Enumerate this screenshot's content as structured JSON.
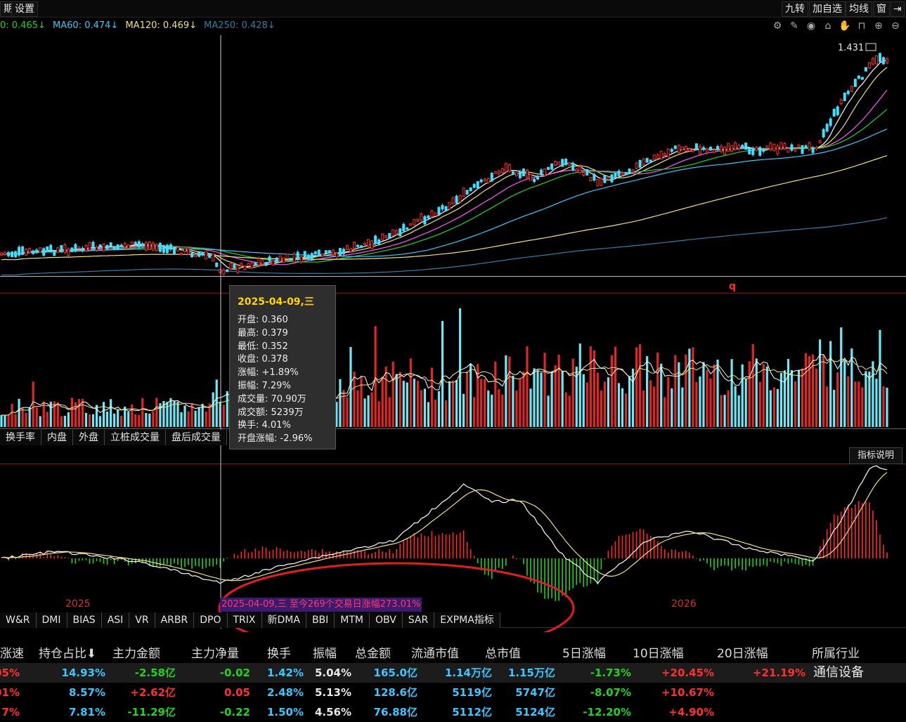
{
  "topbar": {
    "left_buttons": [
      "期",
      "设置"
    ],
    "right_buttons": [
      "九转",
      "加自选",
      "均线",
      "窗"
    ]
  },
  "ma": [
    {
      "label": "0: 0.465↓",
      "color": "#21d321"
    },
    {
      "label": "MA60: 0.474↓",
      "color": "#39c8ff"
    },
    {
      "label": "MA120: 0.469↓",
      "color": "#f2e07a"
    },
    {
      "label": "MA250: 0.428↓",
      "color": "#2f7fa8"
    }
  ],
  "toolbar_icons": [
    "gear-icon",
    "pen-icon",
    "eye-icon",
    "trash-icon",
    "hand-icon",
    "lock-icon",
    "zoom-in-icon",
    "zoom-out-icon"
  ],
  "price_peak_label": "1.431",
  "volume_marker": "q",
  "tooltip": {
    "date": "2025-04-09,三",
    "rows": [
      "开盘: 0.360",
      "最高: 0.379",
      "最低: 0.352",
      "收盘: 0.378",
      "涨幅: +1.89%",
      "振幅: 7.29%",
      "成交量: 70.90万",
      "成交额: 5239万",
      "换手: 4.01%",
      "开盘涨幅: -2.96%"
    ]
  },
  "volume_tabs": [
    "换手率",
    "内盘",
    "外盘",
    "立桩成交量",
    "盘后成交量"
  ],
  "indicator_help": "指标说明",
  "years": [
    "2025",
    "2026"
  ],
  "annotation": "2025-04-09,三 至今269个交易日涨幅273.01%",
  "indicator_tabs": [
    "W&R",
    "DMI",
    "BIAS",
    "ASI",
    "VR",
    "ARBR",
    "DPO",
    "TRIX",
    "新DMA",
    "BBI",
    "MTM",
    "OBV",
    "SAR",
    "EXPMA指标"
  ],
  "table": {
    "headers": [
      "涨速",
      "持仓占比⬇",
      "主力金额",
      "主力净量",
      "换手",
      "振幅",
      "总金额",
      "流通市值",
      "总市值",
      "5日涨幅",
      "10日涨幅",
      "20日涨幅",
      "所属行业"
    ],
    "rows": [
      [
        "05%",
        "14.93%",
        "-2.58亿",
        "-0.02",
        "1.42%",
        "5.04%",
        "165.0亿",
        "1.14万亿",
        "1.15万亿",
        "-1.73%",
        "+20.45%",
        "+21.19%",
        "通信设备"
      ],
      [
        "01%",
        "8.57%",
        "+2.62亿",
        "0.05",
        "2.48%",
        "5.13%",
        "128.6亿",
        "5119亿",
        "5747亿",
        "-8.07%",
        "+10.67%",
        "",
        ""
      ],
      [
        "7%",
        "7.81%",
        "-11.29亿",
        "-0.22",
        "1.50%",
        "4.56%",
        "76.88亿",
        "5112亿",
        "5124亿",
        "-12.20%",
        "+4.90%",
        "",
        ""
      ]
    ],
    "row_colors": [
      [
        "#ff3030",
        "#39c8ff",
        "#21d321",
        "#21d321",
        "#39c8ff",
        "#e8e8e8",
        "#39c8ff",
        "#39c8ff",
        "#39c8ff",
        "#21d321",
        "#ff3030",
        "#ff3030",
        "#e8e8e8"
      ],
      [
        "#ff3030",
        "#39c8ff",
        "#ff3030",
        "#ff3030",
        "#39c8ff",
        "#e8e8e8",
        "#39c8ff",
        "#39c8ff",
        "#39c8ff",
        "#21d321",
        "#ff3030",
        "#ff3030",
        "#e8e8e8"
      ],
      [
        "#ff3030",
        "#39c8ff",
        "#21d321",
        "#21d321",
        "#39c8ff",
        "#e8e8e8",
        "#39c8ff",
        "#39c8ff",
        "#39c8ff",
        "#21d321",
        "#ff3030",
        "#ff3030",
        "#e8e8e8"
      ]
    ]
  }
}
